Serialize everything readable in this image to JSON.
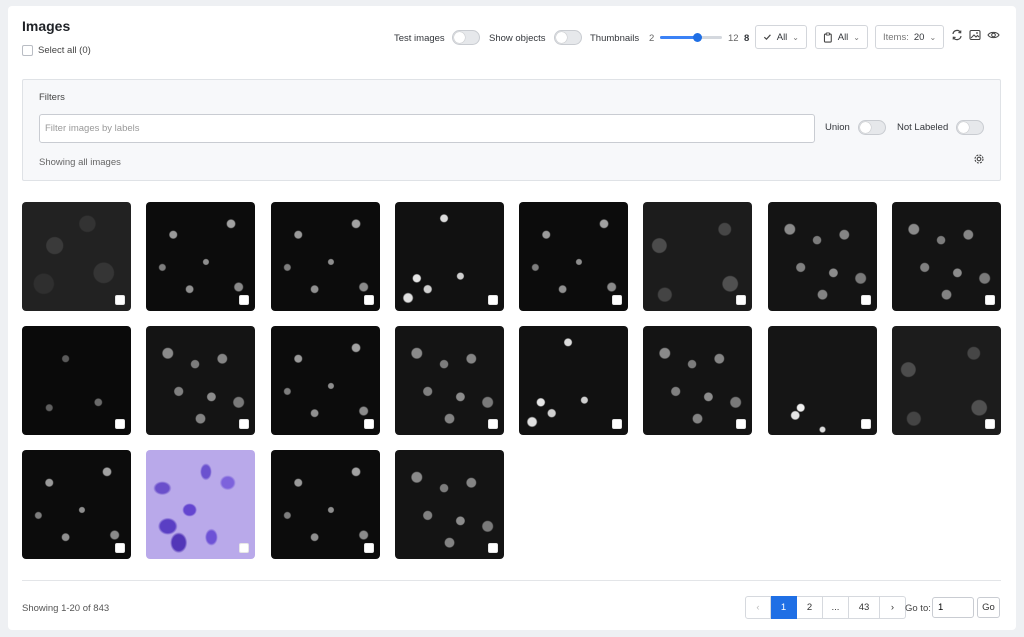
{
  "header": {
    "title": "Images",
    "select_all_label": "Select all (0)"
  },
  "toolbar": {
    "test_images_label": "Test images",
    "show_objects_label": "Show objects",
    "thumbnails_label": "Thumbnails",
    "slider_min": "2",
    "slider_max": "12",
    "slider_value": "8",
    "slider_value_fraction": 0.6,
    "status_filter": "All",
    "type_filter": "All",
    "items_label": "Items:",
    "items_value": "20",
    "icons": [
      "check-icon",
      "clipboard-icon",
      "refresh-icon",
      "image-icon",
      "eye-icon"
    ]
  },
  "filters": {
    "label": "Filters",
    "placeholder": "Filter images by labels",
    "union_label": "Union",
    "not_labeled_label": "Not Labeled",
    "status_text": "Showing all images"
  },
  "images": [
    {
      "style": "gray"
    },
    {
      "style": "dots"
    },
    {
      "style": "dots"
    },
    {
      "style": "bright"
    },
    {
      "style": "dots"
    },
    {
      "style": "big"
    },
    {
      "style": "dense"
    },
    {
      "style": "dense"
    },
    {
      "style": "sparse"
    },
    {
      "style": "dense"
    },
    {
      "style": "dots"
    },
    {
      "style": "dense"
    },
    {
      "style": "bright"
    },
    {
      "style": "dense"
    },
    {
      "style": "few"
    },
    {
      "style": "big"
    },
    {
      "style": "dots"
    },
    {
      "style": "purple"
    },
    {
      "style": "dots"
    },
    {
      "style": "dense"
    }
  ],
  "footer": {
    "showing_text": "Showing 1-20 of 843",
    "pages": [
      "1",
      "2",
      "...",
      "43"
    ],
    "prev": "‹",
    "next": "›",
    "goto_label": "Go to:",
    "goto_value": "1",
    "go_button": "Go"
  },
  "colors": {
    "accent": "#1f6fe5",
    "panel_bg": "#ffffff",
    "page_bg": "#eef0f3"
  }
}
